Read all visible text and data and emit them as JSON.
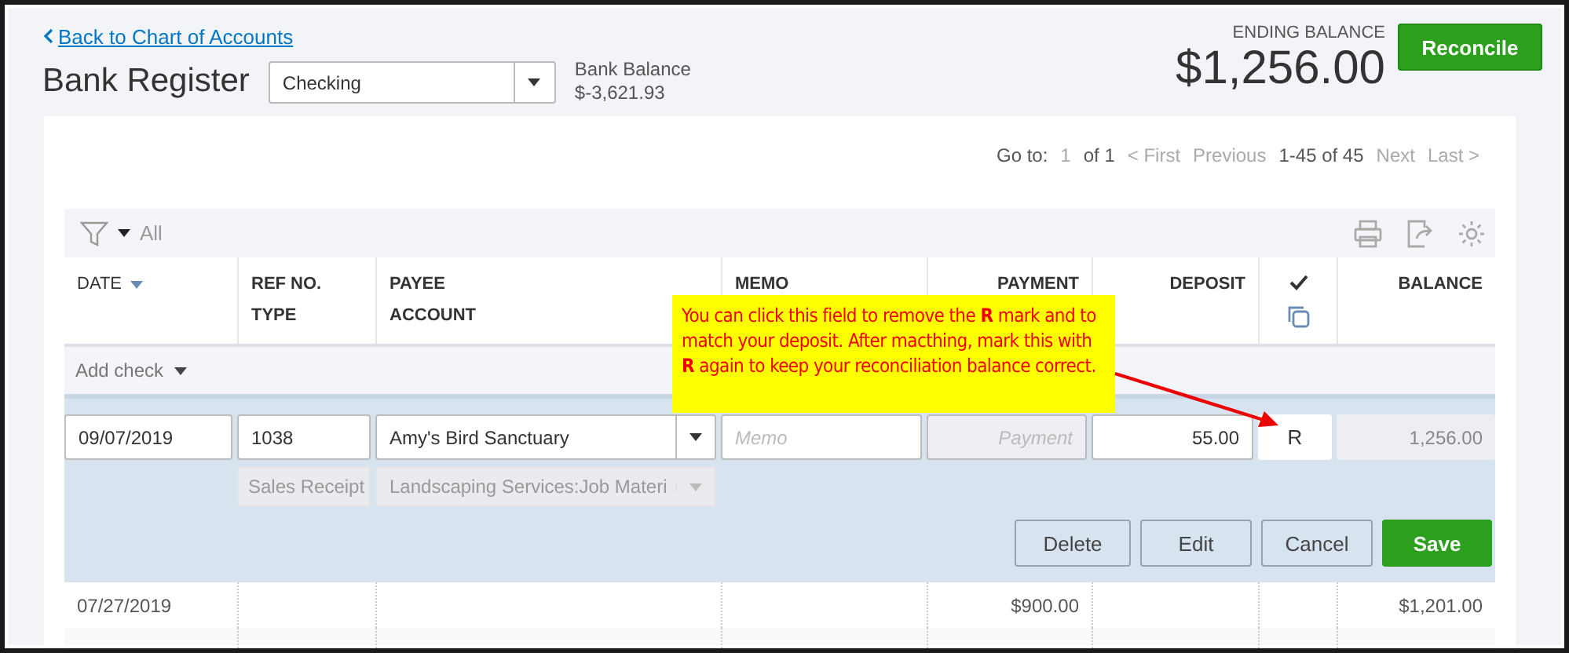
{
  "back_link": "Back to Chart of Accounts",
  "title": "Bank Register",
  "account_select": {
    "value": "Checking"
  },
  "bank_balance": {
    "label": "Bank Balance",
    "value": "$-3,621.93"
  },
  "ending_balance": {
    "label": "ENDING BALANCE",
    "value": "$1,256.00"
  },
  "reconcile_button": "Reconcile",
  "pagination": {
    "goto_label": "Go to:",
    "page": "1",
    "of": "of 1",
    "first": "< First",
    "previous": "Previous",
    "range": "1-45 of 45",
    "next": "Next",
    "last": "Last >"
  },
  "filter": {
    "label": "All"
  },
  "columns": [
    {
      "kind": "text",
      "top": "DATE",
      "sorted": true
    },
    {
      "kind": "text",
      "top": "REF NO.",
      "bottom": "TYPE",
      "sorted": false
    },
    {
      "kind": "text",
      "top": "PAYEE",
      "bottom": "ACCOUNT",
      "sorted": false
    },
    {
      "kind": "text",
      "top": "MEMO",
      "sorted": false
    },
    {
      "kind": "amount",
      "top": "PAYMENT",
      "sorted": false
    },
    {
      "kind": "amount",
      "top": "DEPOSIT",
      "sorted": false
    },
    {
      "kind": "icons",
      "sorted": false
    },
    {
      "kind": "amount",
      "top": "BALANCE",
      "sorted": false
    }
  ],
  "add_check": "Add check",
  "edit_row": {
    "date": "09/07/2019",
    "ref_no": "1038",
    "payee": "Amy's Bird Sanctuary",
    "memo_placeholder": "Memo",
    "payment_placeholder": "Payment",
    "deposit": "55.00",
    "reconcile_status": "R",
    "balance": "1,256.00",
    "type": "Sales Receipt",
    "account": "Landscaping Services:Job Materi",
    "details_disabled": true
  },
  "actions": [
    {
      "label": "Delete",
      "kind": "secondary"
    },
    {
      "label": "Edit",
      "kind": "secondary"
    },
    {
      "label": "Cancel",
      "kind": "secondary"
    },
    {
      "label": "Save",
      "kind": "primary"
    }
  ],
  "rows": [
    {
      "date": "07/27/2019",
      "payment": "$900.00",
      "balance": "$1,201.00"
    }
  ],
  "annotation": {
    "text": "You can click this field to remove the **R** mark and to match your deposit. After macthing, mark this with **R** again to keep your reconciliation balance correct."
  }
}
